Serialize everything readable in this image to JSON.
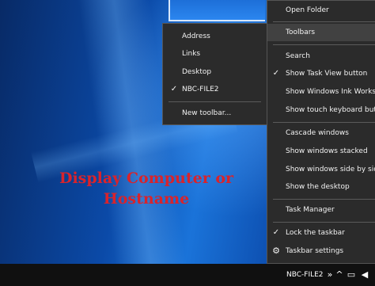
{
  "caption": {
    "line1": "Display Computer or",
    "line2": "Hostname"
  },
  "toolbars_submenu": {
    "items": [
      {
        "label": "Address",
        "checked": false
      },
      {
        "label": "Links",
        "checked": false
      },
      {
        "label": "Desktop",
        "checked": false
      },
      {
        "label": "NBC-FILE2",
        "checked": true
      },
      {
        "label": "New toolbar...",
        "checked": false
      }
    ],
    "check_glyph": "✓"
  },
  "taskbar_menu": {
    "items": [
      {
        "label": "Open Folder"
      },
      {
        "label": "Toolbars",
        "highlighted": true
      },
      {
        "label": "Search"
      },
      {
        "label": "Show Task View button",
        "checked": true
      },
      {
        "label": "Show Windows Ink Workspace button"
      },
      {
        "label": "Show touch keyboard button"
      },
      {
        "label": "Cascade windows"
      },
      {
        "label": "Show windows stacked"
      },
      {
        "label": "Show windows side by side"
      },
      {
        "label": "Show the desktop"
      },
      {
        "label": "Task Manager"
      },
      {
        "label": "Lock the taskbar",
        "checked": true
      },
      {
        "label": "Taskbar settings",
        "icon": "gear-icon"
      }
    ],
    "check_glyph": "✓",
    "gear_glyph": "⚙"
  },
  "taskbar": {
    "toolbar_label": "NBC-FILE2",
    "overflow_glyph": "»",
    "tray_chevron_glyph": "^",
    "network_glyph": "▭",
    "volume_glyph": "◀"
  },
  "colors": {
    "menu_bg": "#2b2b2b",
    "menu_hover": "#414141",
    "caption_red": "#d9232b",
    "taskbar_bg": "#101010"
  }
}
